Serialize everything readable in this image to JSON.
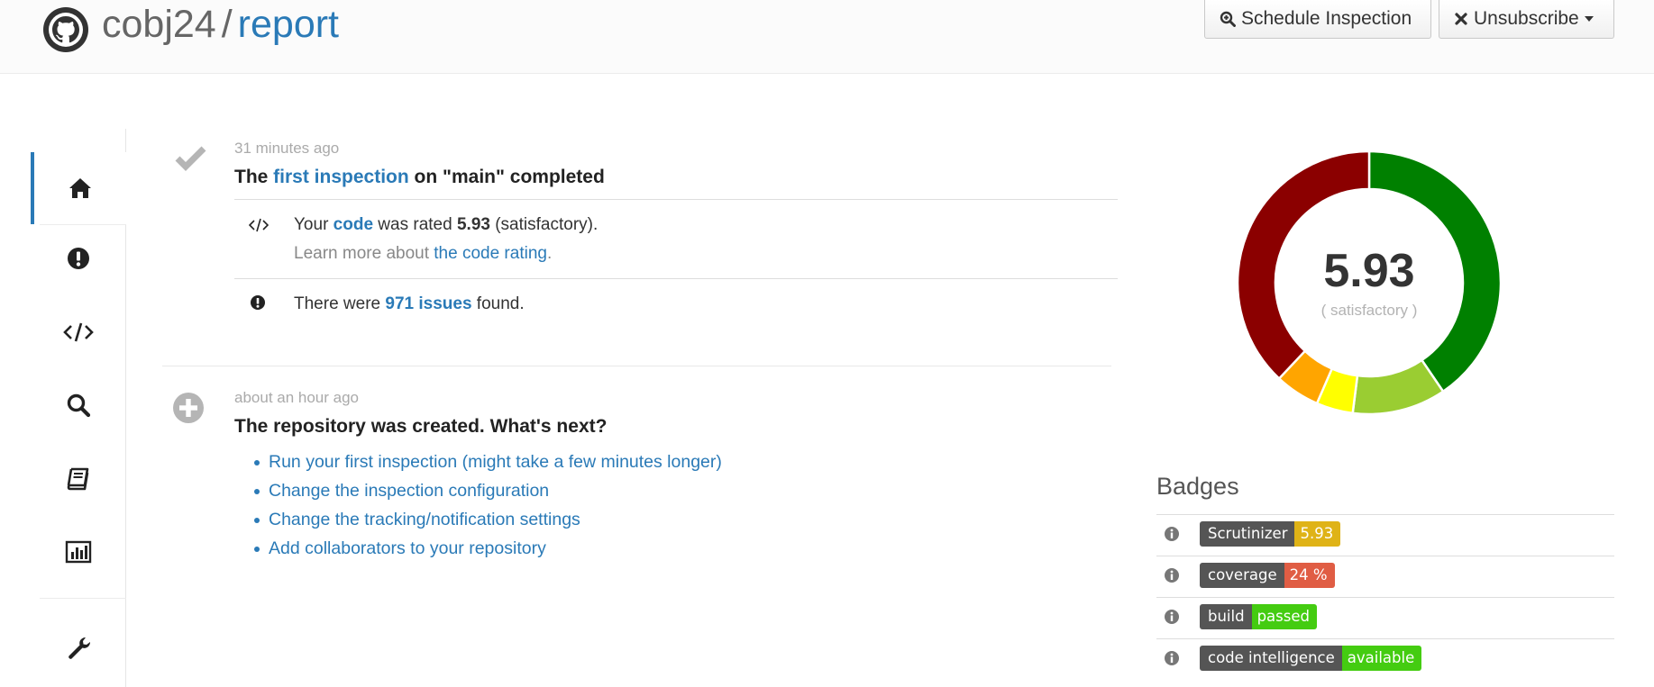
{
  "header": {
    "owner": "cobj24",
    "separator": "/",
    "repo_name": "report",
    "schedule_label": "Schedule Inspection",
    "unsubscribe_label": "Unsubscribe"
  },
  "sidebar": {
    "items": [
      {
        "name": "home-icon",
        "active": true
      },
      {
        "name": "issues-icon",
        "active": false
      },
      {
        "name": "code-icon",
        "active": false
      },
      {
        "name": "search-icon",
        "active": false
      },
      {
        "name": "docs-icon",
        "active": false
      },
      {
        "name": "stats-icon",
        "active": false
      },
      {
        "name": "settings-icon",
        "active": false
      }
    ]
  },
  "timeline": {
    "event1": {
      "time": "31 minutes ago",
      "title_pre": "The ",
      "title_link": "first inspection",
      "title_post": " on \"main\" completed",
      "rating_pre": "Your ",
      "rating_link": "code",
      "rating_mid": " was rated ",
      "rating_value": "5.93",
      "rating_post": " (satisfactory).",
      "learn_pre": "Learn more about ",
      "learn_link": "the code rating",
      "learn_post": ".",
      "issues_pre": "There were ",
      "issues_link": "971 issues",
      "issues_post": " found."
    },
    "event2": {
      "time": "about an hour ago",
      "title": "The repository was created. What's next?",
      "links": [
        "Run your first inspection (might take a few minutes longer)",
        "Change the inspection configuration",
        "Change the tracking/notification settings",
        "Add collaborators to your repository"
      ]
    }
  },
  "rating": {
    "score": "5.93",
    "label": "( satisfactory )",
    "segments": [
      {
        "color": "#008000",
        "fraction": 0.405
      },
      {
        "color": "#9acd32",
        "fraction": 0.115
      },
      {
        "color": "#ffff00",
        "fraction": 0.045
      },
      {
        "color": "#ffa500",
        "fraction": 0.055
      },
      {
        "color": "#8b0000",
        "fraction": 0.38
      }
    ]
  },
  "badges": {
    "title": "Badges",
    "items": [
      {
        "left": "Scrutinizer",
        "right": "5.93",
        "color": "#dfb317"
      },
      {
        "left": "coverage",
        "right": "24 %",
        "color": "#e05d44"
      },
      {
        "left": "build",
        "right": "passed",
        "color": "#44cc11"
      },
      {
        "left": "code intelligence",
        "right": "available",
        "color": "#44cc11"
      }
    ]
  },
  "colors": {
    "link": "#2a7ab7",
    "active_indicator": "#2a7ab7"
  }
}
